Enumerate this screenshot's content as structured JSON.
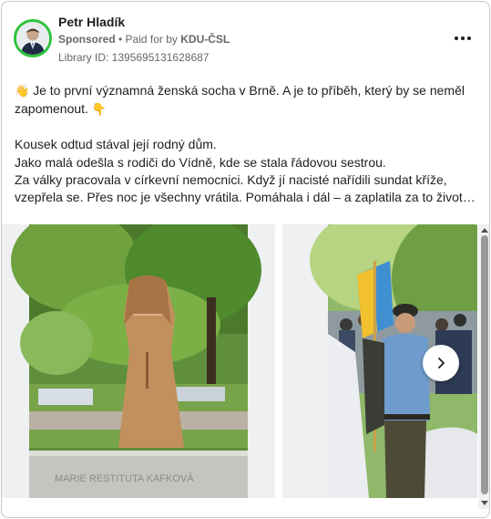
{
  "post": {
    "author": "Petr Hladík",
    "sponsored": "Sponsored",
    "paid_for_prefix": " • Paid for by ",
    "payer": "KDU-ČSL",
    "library_id": "Library ID: 1395695131628687",
    "more_icon": "more-horizontal-icon"
  },
  "body": {
    "emoji_start": "👋",
    "line1": "Je to první významná ženská socha v Brně. A je to příběh, který by se neměl",
    "line2": "zapomenout.",
    "emoji_end": "👇",
    "line3": "Kousek odtud stával její rodný dům.",
    "line4": "Jako malá odešla s rodiči do Vídně, kde se stala řádovou sestrou.",
    "line5": "Za války pracovala v církevní nemocnici. Když jí nacisté nařídili sundat kříže,",
    "line6": "vzepřela se. Přes noc je všechny vrátila. Pomáhala i dál – a zaplatila za to životem."
  },
  "carousel": {
    "slide1_inscription": "MARIE RESTITUTA KAFKOVÁ",
    "next_icon": "chevron-right-icon"
  },
  "colors": {
    "avatar_ring": "#2fc33c",
    "text": "#1c1e21",
    "muted": "#65676b"
  }
}
